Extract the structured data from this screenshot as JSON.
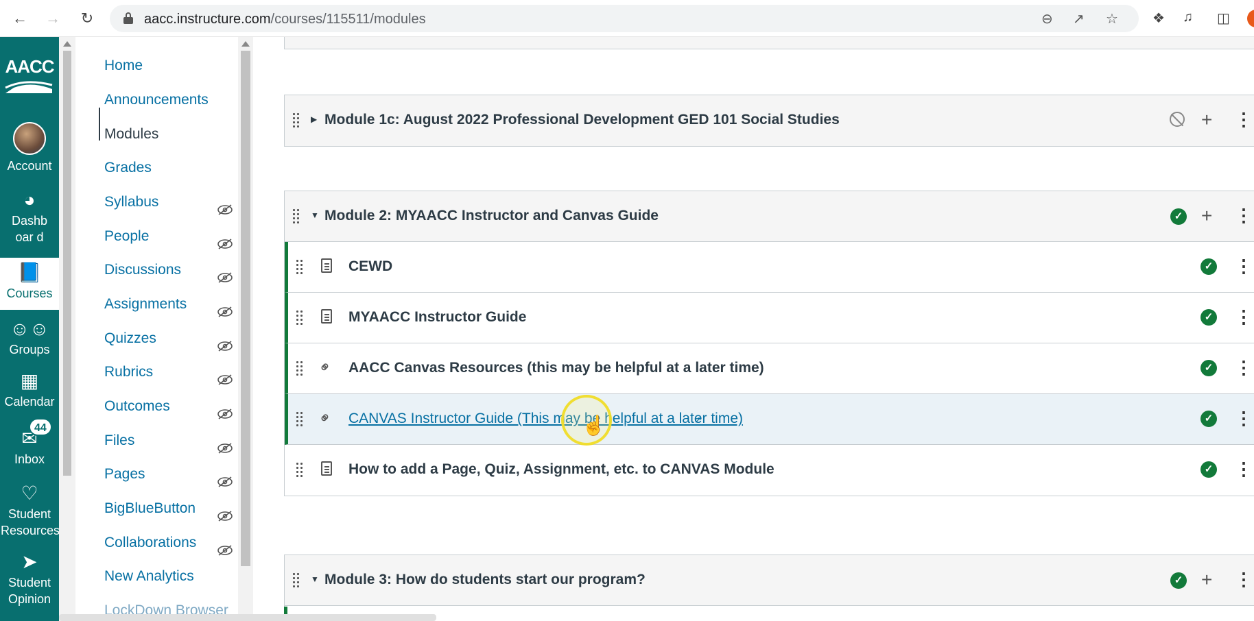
{
  "browser": {
    "url_host": "aacc.instructure.com",
    "url_path": "/courses/115511/modules",
    "back_icon": "arrow-left-icon",
    "forward_icon": "arrow-right-icon",
    "reload_icon": "reload-icon"
  },
  "global_nav": {
    "logo": "AACC",
    "items": [
      {
        "label": "Account",
        "icon": "avatar"
      },
      {
        "label": "Dashboar d",
        "icon": "speedometer-icon"
      },
      {
        "label": "Courses",
        "icon": "book-icon"
      },
      {
        "label": "Groups",
        "icon": "people-icon"
      },
      {
        "label": "Calendar",
        "icon": "calendar-icon"
      },
      {
        "label": "Inbox",
        "icon": "inbox-icon",
        "badge": "44"
      },
      {
        "label": "Student Resources",
        "icon": "badge-icon"
      },
      {
        "label": "Student Opinion",
        "icon": "cursor-icon"
      }
    ]
  },
  "course_nav": {
    "items": [
      {
        "label": "Home"
      },
      {
        "label": "Announcements"
      },
      {
        "label": "Modules"
      },
      {
        "label": "Grades"
      },
      {
        "label": "Syllabus"
      },
      {
        "label": "People"
      },
      {
        "label": "Discussions"
      },
      {
        "label": "Assignments"
      },
      {
        "label": "Quizzes"
      },
      {
        "label": "Rubrics"
      },
      {
        "label": "Outcomes"
      },
      {
        "label": "Files"
      },
      {
        "label": "Pages"
      },
      {
        "label": "BigBlueButton"
      },
      {
        "label": "Collaborations"
      },
      {
        "label": "New Analytics"
      },
      {
        "label": "LockDown Browser"
      }
    ]
  },
  "modules": [
    {
      "title": "Module 1c: August 2022 Professional Development GED 101 Social Studies",
      "status": "unpublished",
      "collapsed": true,
      "items": []
    },
    {
      "title": "Module 2: MYAACC Instructor and Canvas Guide",
      "status": "published",
      "collapsed": false,
      "items": [
        {
          "title": "CEWD",
          "type": "page"
        },
        {
          "title": "MYAACC Instructor Guide",
          "type": "page"
        },
        {
          "title": "AACC Canvas Resources (this may be helpful at a later time)",
          "type": "link"
        },
        {
          "title": "CANVAS Instructor Guide (This may be helpful at a later time)",
          "type": "external-link"
        },
        {
          "title": "How to add a Page, Quiz, Assignment, etc. to CANVAS Module",
          "type": "page"
        }
      ]
    },
    {
      "title": "Module 3: How do students start our program?",
      "status": "published",
      "collapsed": false,
      "items": []
    }
  ],
  "colors": {
    "brand": "#086f6f",
    "link": "#0770a3",
    "published": "#127a3a"
  }
}
